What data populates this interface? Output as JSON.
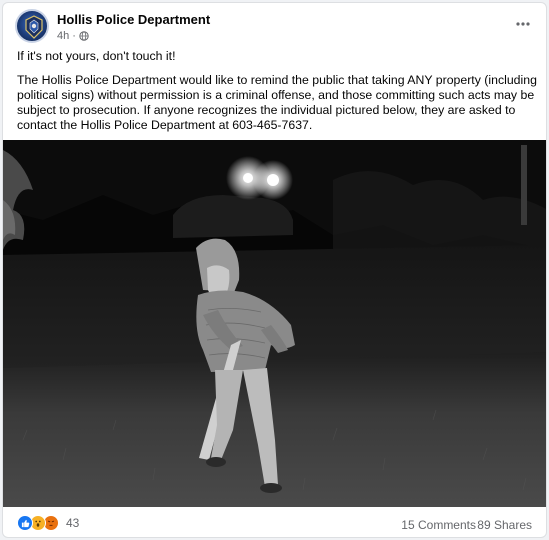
{
  "post": {
    "author": "Hollis Police Department",
    "time": "4h",
    "separator": "·",
    "headline": "If it's not yours, don't touch it!",
    "body": "The Hollis Police Department would like to remind the public that taking ANY property (including political signs) without permission is a criminal offense, and those committing such acts may be subject to prosecution. If anyone recognizes the individual pictured below, they are asked to contact the Hollis Police Department at 603-465-7637.",
    "more_icon": "more-horizontal-icon",
    "audience_icon": "globe-icon"
  },
  "stats": {
    "reaction_icons": [
      "like-icon",
      "wow-icon",
      "angry-icon"
    ],
    "reaction_count": "43",
    "comments": "15 Comments",
    "shares": "89 Shares"
  },
  "colors": {
    "like": "#1877f2",
    "wow": "#f7b125",
    "angry": "#e9710f",
    "secondary_text": "#65676b"
  }
}
